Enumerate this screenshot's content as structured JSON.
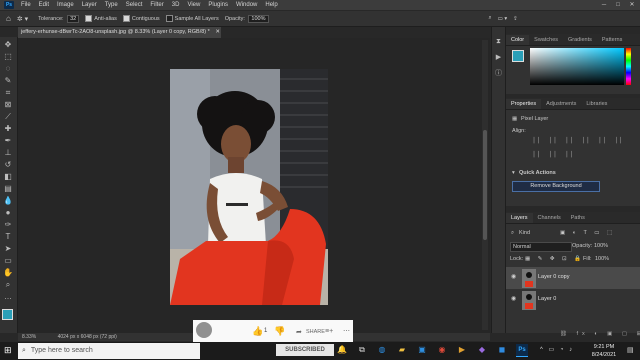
{
  "menubar": {
    "app_logo": "Ps",
    "items": [
      "File",
      "Edit",
      "Image",
      "Layer",
      "Type",
      "Select",
      "Filter",
      "3D",
      "View",
      "Plugins",
      "Window",
      "Help"
    ]
  },
  "options": {
    "tolerance_label": "Tolerance:",
    "tolerance_value": "32",
    "anti_alias": "Anti-alias",
    "contiguous": "Contiguous",
    "sample_all_layers": "Sample All Layers",
    "opacity_label": "Opacity:",
    "opacity_value": "100%"
  },
  "document": {
    "tab_title": "jeffery-erhunse-dBwrTc-2AO8-unsplash.jpg @ 8.33% (Layer 0 copy, RGB/8) *",
    "zoom": "8.33%",
    "dimensions": "4024 px x 6048 px (72 ppi)"
  },
  "color_panel": {
    "tabs": [
      "Color",
      "Swatches",
      "Gradients",
      "Patterns"
    ],
    "foreground_color": "#2a9fb8",
    "hue_color": "#00c8ff"
  },
  "properties_panel": {
    "tabs": [
      "Properties",
      "Adjustments",
      "Libraries"
    ],
    "layer_type": "Pixel Layer",
    "align_label": "Align:",
    "quick_actions_label": "Quick Actions",
    "remove_background_button": "Remove Background"
  },
  "layers_panel": {
    "tabs": [
      "Layers",
      "Channels",
      "Paths"
    ],
    "filter_kind": "Kind",
    "blend_mode": "Normal",
    "opacity_label": "Opacity:",
    "opacity_value": "100%",
    "lock_label": "Lock:",
    "fill_label": "Fill:",
    "fill_value": "100%",
    "layers": [
      {
        "name": "Layer 0 copy",
        "selected": true
      },
      {
        "name": "Layer 0",
        "selected": false
      }
    ]
  },
  "youtube_overlay": {
    "like_count": "1",
    "share_label": "SHARE"
  },
  "taskbar": {
    "search_placeholder": "Type here to search",
    "subscribed_label": "SUBSCRIBED",
    "time": "9:21 PM",
    "date": "8/24/2021"
  }
}
